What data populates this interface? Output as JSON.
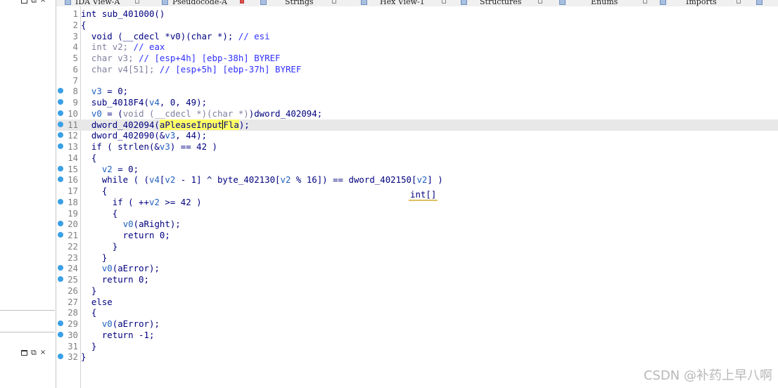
{
  "left_panel": {
    "top_controls": [
      "▭",
      "⧉",
      "×"
    ],
    "bottom_controls": [
      "▭",
      "⧉",
      "×"
    ]
  },
  "tabs": [
    {
      "label": "IDA View-A",
      "active": false
    },
    {
      "label": "Pseudocode-A",
      "active": true
    },
    {
      "label": "Strings",
      "active": false
    },
    {
      "label": "Hex View-1",
      "active": false
    },
    {
      "label": "Structures",
      "active": false
    },
    {
      "label": "Enums",
      "active": false
    },
    {
      "label": "Imports",
      "active": false
    }
  ],
  "colors": {
    "keyword": "#000080",
    "comment": "#3030ff",
    "variable": "#2060c0",
    "highlight": "#ffff66",
    "breakpoint": "#3aa0e6"
  },
  "code_lines": [
    {
      "n": "1",
      "bp": false,
      "html": "int sub_401000()"
    },
    {
      "n": "2",
      "bp": false,
      "html": "{"
    },
    {
      "n": "3",
      "bp": false,
      "html": "  void (__cdecl *v0)(char *); <span class='c-cm'>// esi</span>"
    },
    {
      "n": "4",
      "bp": false,
      "html": "  <span class='c-gr'>int v2;</span> <span class='c-cm'>// eax</span>"
    },
    {
      "n": "5",
      "bp": false,
      "html": "  <span class='c-gr'>char v3;</span> <span class='c-cm'>// [esp+4h] [ebp-38h] BYREF</span>"
    },
    {
      "n": "6",
      "bp": false,
      "html": "  <span class='c-gr'>char v4[51];</span> <span class='c-cm'>// [esp+5h] [ebp-37h] BYREF</span>"
    },
    {
      "n": "7",
      "bp": false,
      "html": ""
    },
    {
      "n": "8",
      "bp": true,
      "html": "  <span class='c-var'>v3</span> = 0;"
    },
    {
      "n": "9",
      "bp": true,
      "html": "  sub_4018F4(<span class='c-var'>v4</span>, 0, 49);"
    },
    {
      "n": "10",
      "bp": true,
      "html": "  <span class='c-var'>v0</span> = (<span class='c-gr'>void (__cdecl *)(char *)</span>)dword_402094;"
    },
    {
      "n": "11",
      "bp": true,
      "current": true,
      "html": "  dword_402094(<span class='c-hl'>aPleaseInput<span class='cursor'></span>Fla</span>);"
    },
    {
      "n": "12",
      "bp": true,
      "html": "  dword_402090(&amp;<span class='c-var'>v3</span>, 44);"
    },
    {
      "n": "13",
      "bp": true,
      "html": "  if ( strlen(&amp;<span class='c-var'>v3</span>) == 42 )"
    },
    {
      "n": "14",
      "bp": false,
      "html": "  {"
    },
    {
      "n": "15",
      "bp": true,
      "html": "    <span class='c-var'>v2</span> = 0;"
    },
    {
      "n": "16",
      "bp": true,
      "html": "    while ( (<span class='c-var'>v4</span>[<span class='c-var'>v2</span> - 1] ^ byte_402130[<span class='c-var'>v2</span> % 16]) == dword_402150[<span class='c-var'>v2</span>] )"
    },
    {
      "n": "17",
      "bp": false,
      "html": "    {"
    },
    {
      "n": "18",
      "bp": true,
      "html": "      if ( ++<span class='c-var'>v2</span> >= 42 )"
    },
    {
      "n": "19",
      "bp": false,
      "html": "      {"
    },
    {
      "n": "20",
      "bp": true,
      "html": "        <span class='c-var'>v0</span>(aRight);"
    },
    {
      "n": "21",
      "bp": true,
      "html": "        return 0;"
    },
    {
      "n": "22",
      "bp": false,
      "html": "      }"
    },
    {
      "n": "23",
      "bp": false,
      "html": "    }"
    },
    {
      "n": "24",
      "bp": true,
      "html": "    <span class='c-var'>v0</span>(aError);"
    },
    {
      "n": "25",
      "bp": true,
      "html": "    return 0;"
    },
    {
      "n": "26",
      "bp": false,
      "html": "  }"
    },
    {
      "n": "27",
      "bp": false,
      "html": "  else"
    },
    {
      "n": "28",
      "bp": false,
      "html": "  {"
    },
    {
      "n": "29",
      "bp": true,
      "html": "    <span class='c-var'>v0</span>(aError);"
    },
    {
      "n": "30",
      "bp": true,
      "html": "    return -1;"
    },
    {
      "n": "31",
      "bp": false,
      "html": "  }"
    },
    {
      "n": "32",
      "bp": true,
      "html": "}"
    }
  ],
  "hint": "int[]",
  "watermark": "CSDN @补药上早八啊"
}
